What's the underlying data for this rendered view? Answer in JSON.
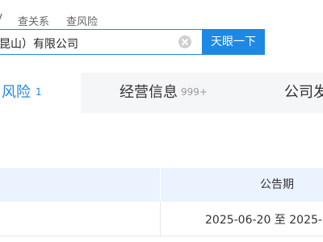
{
  "top_links": {
    "partial_link": "V",
    "relations_link": "查关系",
    "risk_link": "查风险"
  },
  "search": {
    "value": "昆山）有限公司",
    "button_label": "天眼一下"
  },
  "tabs": [
    {
      "label": "风险",
      "count": "1",
      "active": true
    },
    {
      "label": "经营信息",
      "count": "999+",
      "active": false
    },
    {
      "label": "公司发",
      "count": "",
      "active": false
    }
  ],
  "table": {
    "headers": {
      "announcement_period": "公告期"
    },
    "rows": [
      {
        "announcement_period": "2025-06-20 至 2025-0"
      }
    ]
  },
  "colors": {
    "accent": "#1e88e5",
    "tab_bg": "#f5f6f8",
    "header_bg": "#eaf3ff"
  }
}
